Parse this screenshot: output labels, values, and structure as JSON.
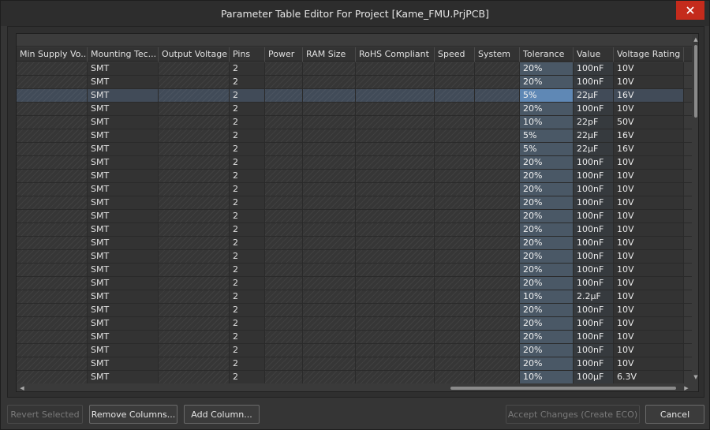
{
  "window": {
    "title": "Parameter Table Editor For Project [Kame_FMU.PrjPCB]",
    "close_icon": "close-icon",
    "accent_close": "#c42b1c"
  },
  "table": {
    "columns": [
      "Min Supply Vo...",
      "Mounting Tec...",
      "Output Voltage",
      "Pins",
      "Power",
      "RAM Size",
      "RoHS Compliant",
      "Speed",
      "System",
      "Tolerance",
      "Value",
      "Voltage Rating"
    ],
    "rows": [
      {
        "mounting": "SMT",
        "pins": "2",
        "tolerance": "20%",
        "value": "100nF",
        "voltage": "10V"
      },
      {
        "mounting": "SMT",
        "pins": "2",
        "tolerance": "20%",
        "value": "100nF",
        "voltage": "10V"
      },
      {
        "mounting": "SMT",
        "pins": "2",
        "tolerance": "5%",
        "value": "22µF",
        "voltage": "16V"
      },
      {
        "mounting": "SMT",
        "pins": "2",
        "tolerance": "20%",
        "value": "100nF",
        "voltage": "10V"
      },
      {
        "mounting": "SMT",
        "pins": "2",
        "tolerance": "10%",
        "value": "22pF",
        "voltage": "50V"
      },
      {
        "mounting": "SMT",
        "pins": "2",
        "tolerance": "5%",
        "value": "22µF",
        "voltage": "16V"
      },
      {
        "mounting": "SMT",
        "pins": "2",
        "tolerance": "5%",
        "value": "22µF",
        "voltage": "16V"
      },
      {
        "mounting": "SMT",
        "pins": "2",
        "tolerance": "20%",
        "value": "100nF",
        "voltage": "10V"
      },
      {
        "mounting": "SMT",
        "pins": "2",
        "tolerance": "20%",
        "value": "100nF",
        "voltage": "10V"
      },
      {
        "mounting": "SMT",
        "pins": "2",
        "tolerance": "20%",
        "value": "100nF",
        "voltage": "10V"
      },
      {
        "mounting": "SMT",
        "pins": "2",
        "tolerance": "20%",
        "value": "100nF",
        "voltage": "10V"
      },
      {
        "mounting": "SMT",
        "pins": "2",
        "tolerance": "20%",
        "value": "100nF",
        "voltage": "10V"
      },
      {
        "mounting": "SMT",
        "pins": "2",
        "tolerance": "20%",
        "value": "100nF",
        "voltage": "10V"
      },
      {
        "mounting": "SMT",
        "pins": "2",
        "tolerance": "20%",
        "value": "100nF",
        "voltage": "10V"
      },
      {
        "mounting": "SMT",
        "pins": "2",
        "tolerance": "20%",
        "value": "100nF",
        "voltage": "10V"
      },
      {
        "mounting": "SMT",
        "pins": "2",
        "tolerance": "20%",
        "value": "100nF",
        "voltage": "10V"
      },
      {
        "mounting": "SMT",
        "pins": "2",
        "tolerance": "20%",
        "value": "100nF",
        "voltage": "10V"
      },
      {
        "mounting": "SMT",
        "pins": "2",
        "tolerance": "10%",
        "value": "2.2µF",
        "voltage": "10V"
      },
      {
        "mounting": "SMT",
        "pins": "2",
        "tolerance": "20%",
        "value": "100nF",
        "voltage": "10V"
      },
      {
        "mounting": "SMT",
        "pins": "2",
        "tolerance": "20%",
        "value": "100nF",
        "voltage": "10V"
      },
      {
        "mounting": "SMT",
        "pins": "2",
        "tolerance": "20%",
        "value": "100nF",
        "voltage": "10V"
      },
      {
        "mounting": "SMT",
        "pins": "2",
        "tolerance": "20%",
        "value": "100nF",
        "voltage": "10V"
      },
      {
        "mounting": "SMT",
        "pins": "2",
        "tolerance": "20%",
        "value": "100nF",
        "voltage": "10V"
      },
      {
        "mounting": "SMT",
        "pins": "2",
        "tolerance": "10%",
        "value": "100µF",
        "voltage": "6.3V"
      }
    ],
    "selected_row": 2
  },
  "buttons": {
    "revert_selected": "Revert Selected",
    "remove_columns": "Remove Columns...",
    "add_column": "Add Column...",
    "accept_changes": "Accept Changes (Create ECO)",
    "cancel": "Cancel"
  }
}
